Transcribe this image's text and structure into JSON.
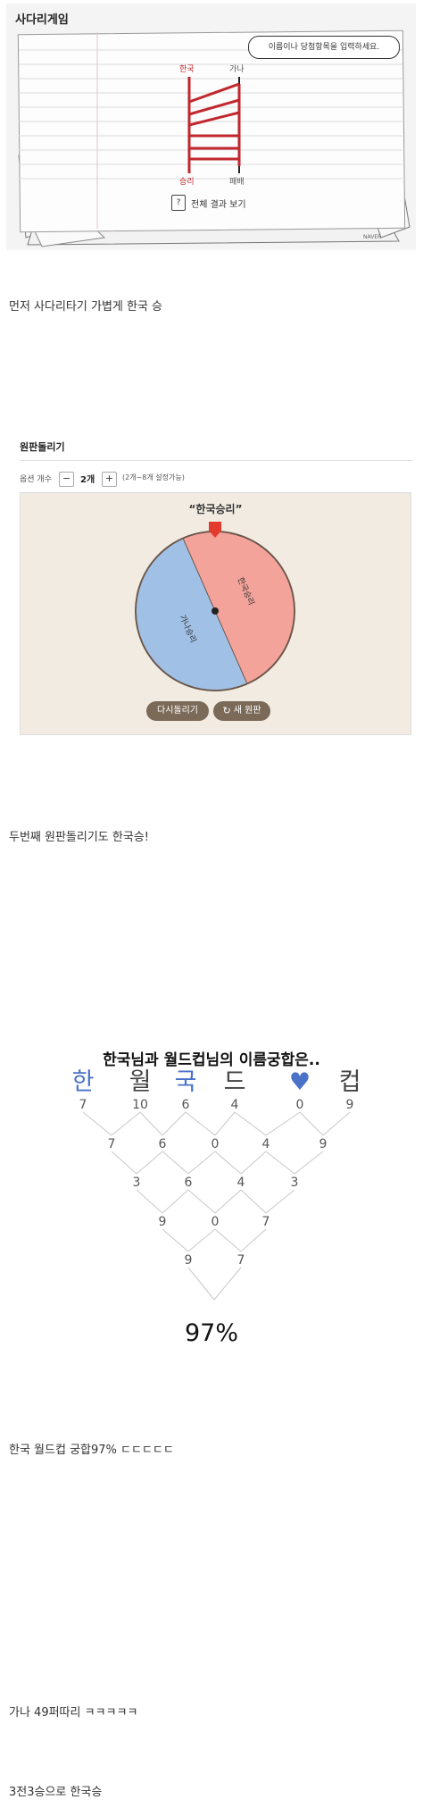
{
  "ladder": {
    "title": "사다리게임",
    "speech_bubble": "이름이나 당첨항목을 입력하세요.",
    "top_labels": [
      "한국",
      "가나"
    ],
    "bottom_labels": [
      "승리",
      "패배"
    ],
    "result_button": "전체 결과 보기",
    "brand": "NAVER"
  },
  "captions": {
    "c1": "먼저 사다리타기 가볍게 한국 승",
    "c2": "두번째 원판돌리기도 한국승!",
    "c3": "한국 월드컵 궁합97% ㄷㄷㄷㄷㄷ",
    "c4": "가나 49퍼따리 ㅋㅋㅋㅋㅋ",
    "c5": "3전3승으로 한국승"
  },
  "roulette": {
    "title": "원판돌리기",
    "option_count_label": "옵션 개수",
    "option_count": "2개",
    "minus": "−",
    "plus": "+",
    "range_hint": "(2개~8개 설정가능)",
    "result": "“한국승리”",
    "slices": [
      {
        "label": "한국승리",
        "color": "#f4a39b"
      },
      {
        "label": "가나승리",
        "color": "#a0c0e6"
      }
    ],
    "spin_again": "다시돌리기",
    "new_wheel": "새 원판",
    "pointer_color": "#e23b2e"
  },
  "compat": {
    "title": "한국님과 월드컵님의 이름궁합은..",
    "chars": [
      {
        "ch": "한",
        "color": "#4a72c8"
      },
      {
        "ch": "월",
        "color": "#444444"
      },
      {
        "ch": "국",
        "color": "#4a72c8"
      },
      {
        "ch": "드",
        "color": "#444444"
      },
      {
        "ch": "♥",
        "color": "#4a72c8"
      },
      {
        "ch": "컵",
        "color": "#444444"
      }
    ],
    "rows": [
      [
        "7",
        "10",
        "6",
        "4",
        "0",
        "9"
      ],
      [
        "7",
        "6",
        "0",
        "4",
        "9"
      ],
      [
        "3",
        "6",
        "4",
        "3"
      ],
      [
        "9",
        "0",
        "7"
      ],
      [
        "9",
        "7"
      ]
    ],
    "percent": "97%"
  }
}
